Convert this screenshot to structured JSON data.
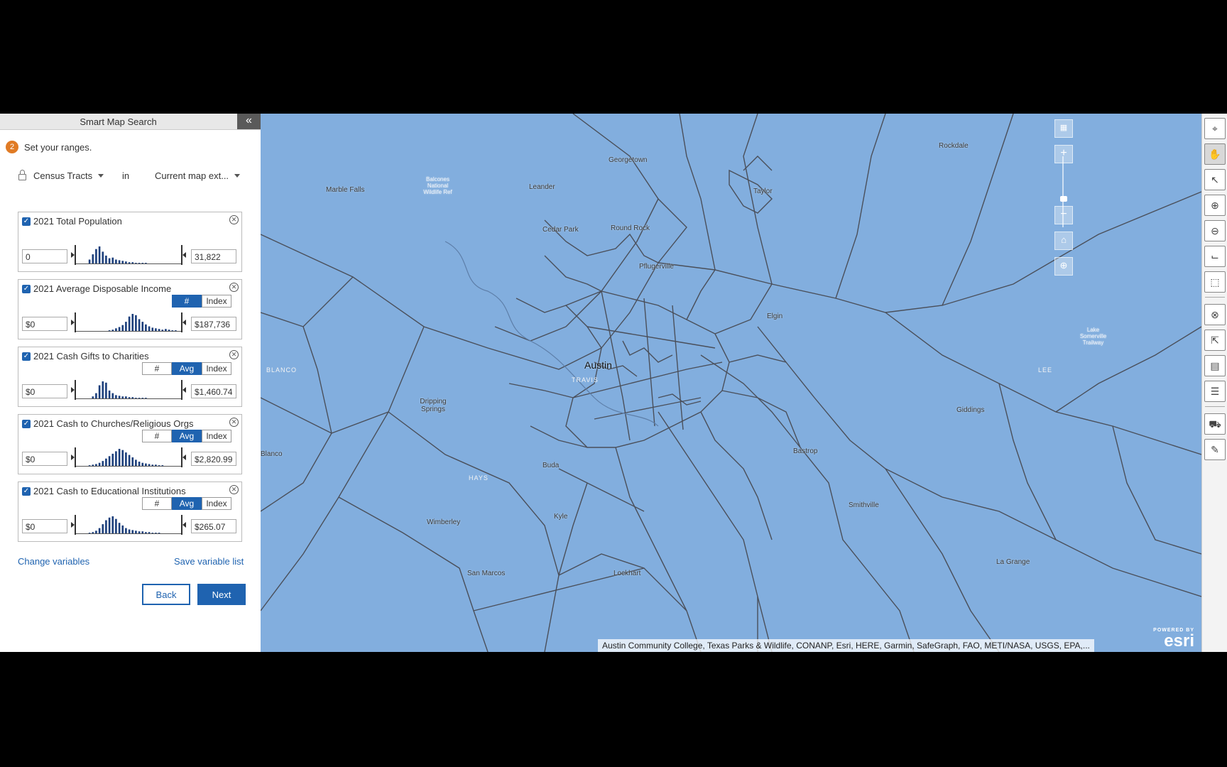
{
  "panel": {
    "title": "Smart Map Search",
    "step_number": "2",
    "step_text": "Set your ranges.",
    "geography": "Census Tracts",
    "in_label": "in",
    "extent": "Current map ext...",
    "variables": [
      {
        "name": "2021 Total Population",
        "min": "0",
        "max": "31,822",
        "toggles": [],
        "active": ""
      },
      {
        "name": "2021 Average Disposable Income",
        "min": "$0",
        "max": "$187,736",
        "toggles": [
          "#",
          "Index"
        ],
        "active": "#"
      },
      {
        "name": "2021 Cash Gifts to Charities",
        "min": "$0",
        "max": "$1,460.74",
        "toggles": [
          "#",
          "Avg",
          "Index"
        ],
        "active": "Avg"
      },
      {
        "name": "2021 Cash to Churches/Religious Orgs",
        "min": "$0",
        "max": "$2,820.99",
        "toggles": [
          "#",
          "Avg",
          "Index"
        ],
        "active": "Avg"
      },
      {
        "name": "2021 Cash to Educational Institutions",
        "min": "$0",
        "max": "$265.07",
        "toggles": [
          "#",
          "Avg",
          "Index"
        ],
        "active": "Avg"
      }
    ],
    "histograms": [
      [
        0,
        0,
        0,
        6,
        14,
        22,
        26,
        18,
        12,
        8,
        9,
        6,
        5,
        4,
        3,
        2,
        2,
        1,
        1,
        1,
        1,
        0,
        0,
        0,
        0,
        0,
        0,
        0,
        0,
        0
      ],
      [
        0,
        0,
        0,
        0,
        0,
        0,
        0,
        0,
        0,
        1,
        2,
        4,
        6,
        9,
        14,
        22,
        26,
        24,
        18,
        14,
        10,
        7,
        5,
        4,
        3,
        2,
        3,
        2,
        1,
        1
      ],
      [
        0,
        0,
        0,
        0,
        3,
        8,
        20,
        26,
        24,
        12,
        8,
        5,
        4,
        3,
        3,
        2,
        2,
        1,
        1,
        1,
        1,
        0,
        0,
        0,
        0,
        0,
        0,
        0,
        0,
        0
      ],
      [
        0,
        0,
        0,
        1,
        2,
        3,
        5,
        8,
        12,
        16,
        20,
        24,
        28,
        26,
        22,
        18,
        14,
        10,
        7,
        5,
        4,
        3,
        2,
        2,
        1,
        1,
        0,
        0,
        0,
        0
      ],
      [
        0,
        0,
        0,
        1,
        2,
        4,
        8,
        14,
        20,
        24,
        26,
        22,
        16,
        12,
        8,
        6,
        5,
        4,
        3,
        3,
        2,
        2,
        1,
        1,
        1,
        0,
        0,
        0,
        0,
        0
      ]
    ],
    "change_variables": "Change variables",
    "save_variable_list": "Save variable list",
    "back": "Back",
    "next": "Next"
  },
  "map": {
    "places": [
      {
        "name": "Georgetown"
      },
      {
        "name": "Leander"
      },
      {
        "name": "Marble Falls"
      },
      {
        "name": "Cedar Park"
      },
      {
        "name": "Round Rock"
      },
      {
        "name": "Pflugerville"
      },
      {
        "name": "Taylor"
      },
      {
        "name": "Rockdale"
      },
      {
        "name": "Elgin"
      },
      {
        "name": "Austin"
      },
      {
        "name": "Dripping Springs"
      },
      {
        "name": "Bastrop"
      },
      {
        "name": "Giddings"
      },
      {
        "name": "Buda"
      },
      {
        "name": "Kyle"
      },
      {
        "name": "Wimberley"
      },
      {
        "name": "San Marcos"
      },
      {
        "name": "Lockhart"
      },
      {
        "name": "Smithville"
      },
      {
        "name": "La Grange"
      },
      {
        "name": "Blanco"
      },
      {
        "name": "Balcones National Wildlife Ref"
      },
      {
        "name": "Lake Somerville Trailway"
      }
    ],
    "counties": [
      "BLANCO",
      "TRAVIS",
      "HAYS",
      "LEE"
    ],
    "attribution": "Austin Community College, Texas Parks & Wildlife, CONANP, Esri, HERE, Garmin, SafeGraph, FAO, METI/NASA, USGS, EPA,...",
    "esri_powered": "POWERED BY",
    "esri_logo": "esri"
  },
  "colors": {
    "accent": "#1f63b0",
    "map_fill": "#82aede",
    "step_badge": "#e07b25"
  }
}
